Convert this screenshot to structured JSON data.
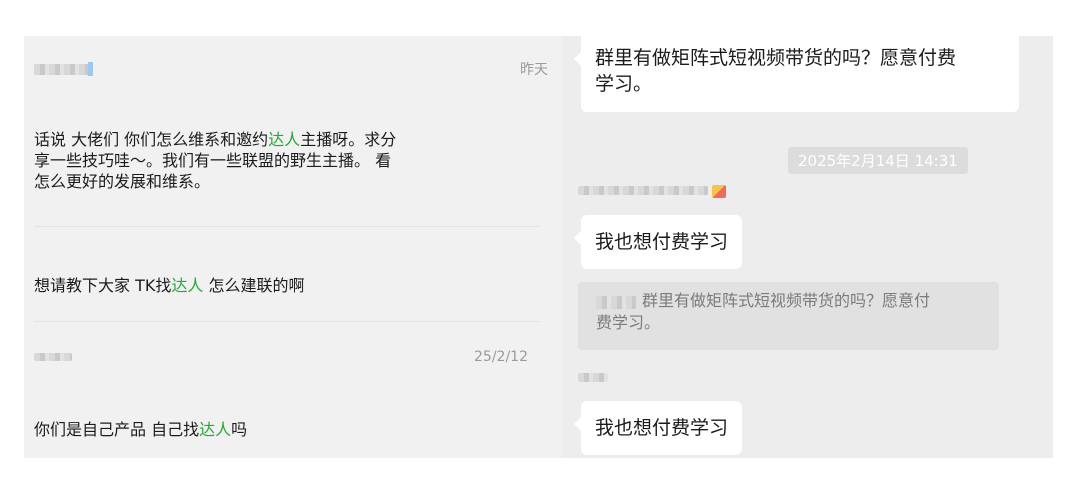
{
  "left_chat": {
    "items": [
      {
        "time": "昨天",
        "text_parts": [
          "话说 大佬们 你们怎么维系和邀约",
          "达人",
          "主播呀。求分\n享一些技巧哇～。我们有一些联盟的野生主播。 看\n怎么更好的发展和维系。"
        ]
      },
      {
        "text_parts": [
          "想请教下大家 TK找",
          "达人",
          " 怎么建联的啊"
        ]
      },
      {
        "time": "25/2/12",
        "text_parts": [
          "你们是自己产品 自己找",
          "达人",
          "吗"
        ]
      }
    ]
  },
  "right_chat": {
    "top_bubble": "群里有做矩阵式短视频带货的吗？愿意付费\n学习。",
    "timestamp": "2025年2月14日 14:31",
    "reply1": "我也想付费学习",
    "quote": "群里有做矩阵式短视频带货的吗？愿意付\n费学习。",
    "reply2": "我也想付费学习"
  },
  "colors": {
    "highlight": "#27a83a",
    "panel_bg": "#f1f1f1",
    "bubble_bg": "#ffffff"
  }
}
